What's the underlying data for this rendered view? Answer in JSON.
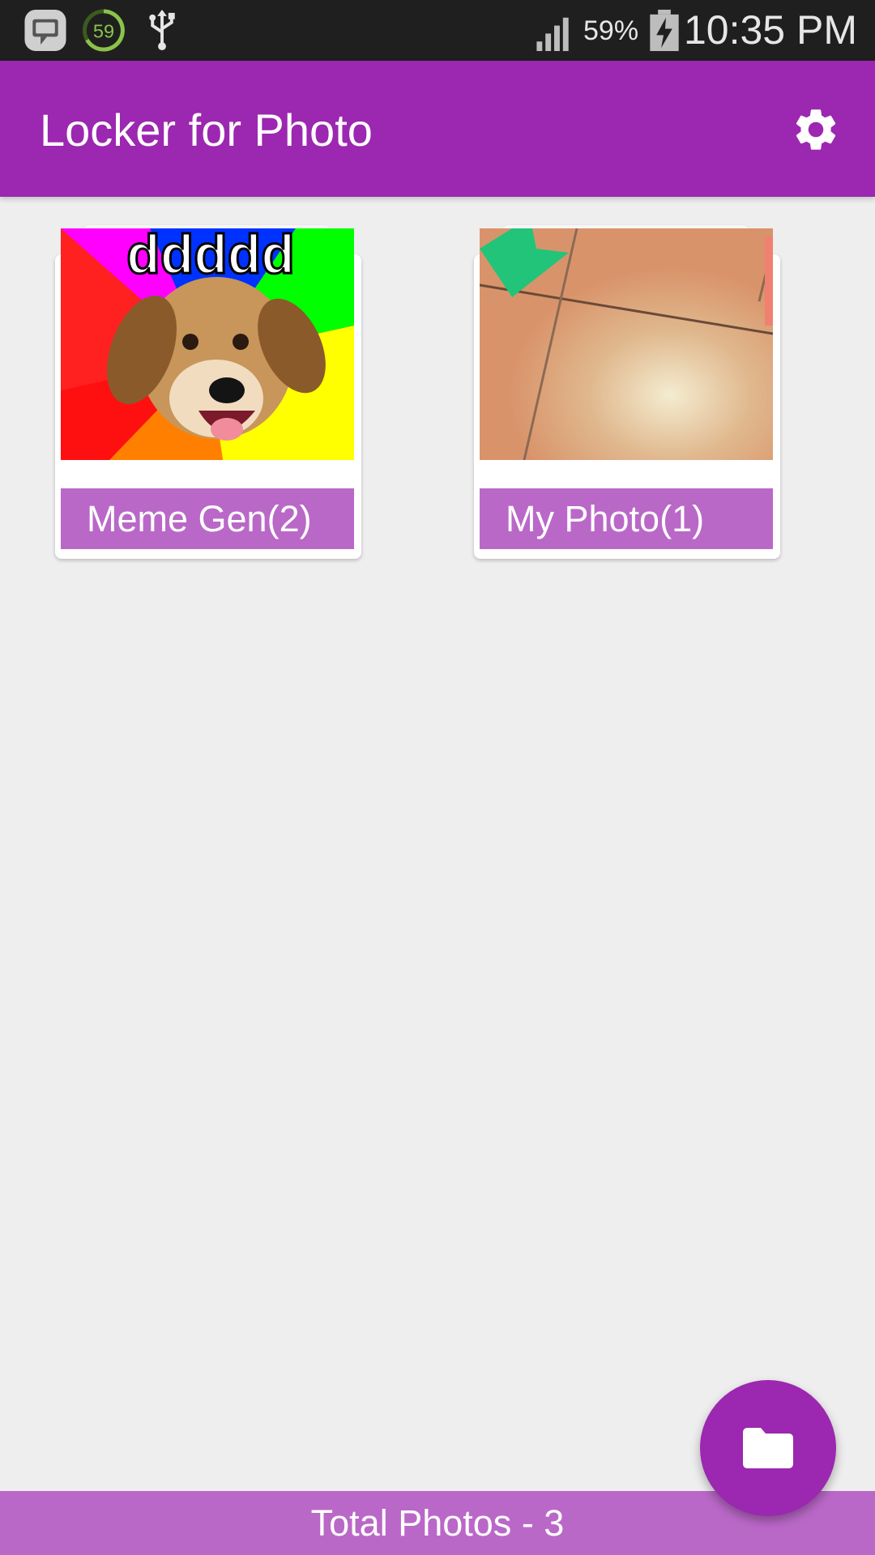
{
  "status_bar": {
    "notification_count": "59",
    "battery_percent": "59%",
    "time": "10:35 PM"
  },
  "app_bar": {
    "title": "Locker for Photo",
    "settings_icon": "gear-icon"
  },
  "albums": [
    {
      "label": "Meme Gen(2)",
      "thumb_caption": "ddddd"
    },
    {
      "label": "My Photo(1)"
    }
  ],
  "fab": {
    "icon": "folder-icon"
  },
  "footer": {
    "text": "Total Photos - 3"
  },
  "colors": {
    "primary": "#9c27b0",
    "primary_light": "#ba68c8",
    "background": "#eeeeee",
    "status_bar": "#1f1f1f"
  }
}
